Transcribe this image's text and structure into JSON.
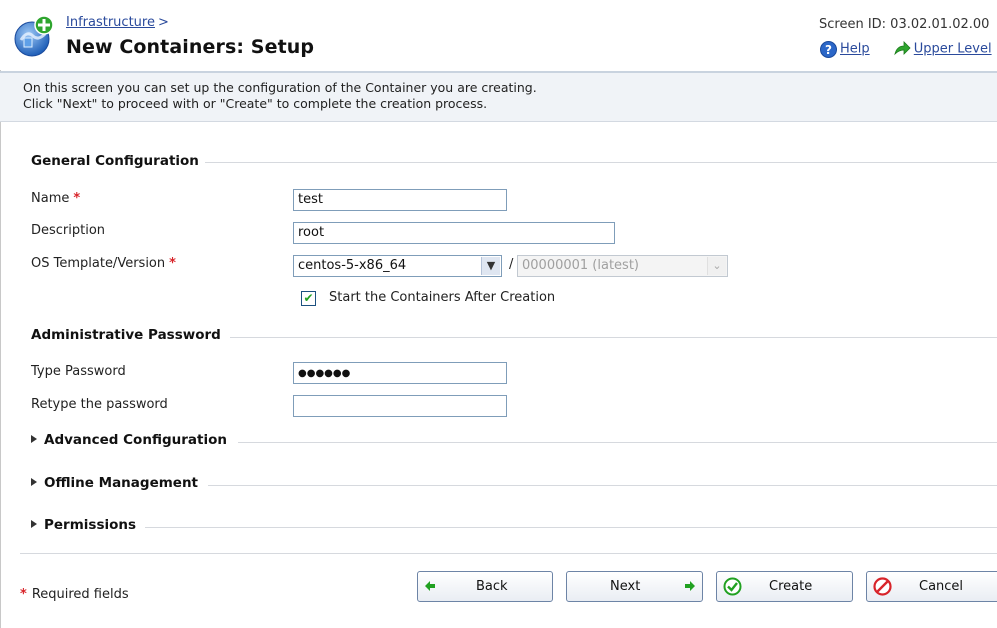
{
  "header": {
    "breadcrumb": "Infrastructure",
    "breadcrumb_sep": ">",
    "title": "New Containers: Setup",
    "screen_id": "Screen ID: 03.02.01.02.00",
    "help_label": "Help",
    "upper_level_label": "Upper Level"
  },
  "info": {
    "line1": "On this screen you can set up the configuration of the Container you are creating.",
    "line2": "Click \"Next\" to proceed with or \"Create\" to complete the creation process."
  },
  "general": {
    "title": "General Configuration",
    "name_label": "Name",
    "name_value": "test",
    "description_label": "Description",
    "description_value": "root",
    "os_label": "OS Template/Version",
    "os_template": "centos-5-x86_64",
    "os_version": "00000001 (latest)",
    "slash": "/",
    "start_after_label": "Start the Containers After Creation"
  },
  "password": {
    "title": "Administrative Password",
    "type_label": "Type Password",
    "type_value": "●●●●●●",
    "retype_label": "Retype the password",
    "retype_value": ""
  },
  "collapsed_sections": {
    "advanced": "Advanced Configuration",
    "offline": "Offline Management",
    "permissions": "Permissions"
  },
  "footer": {
    "required_star": "*",
    "required_note": "Required fields",
    "back": "Back",
    "next": "Next",
    "create": "Create",
    "cancel": "Cancel"
  },
  "icons": {
    "logo": "container-add-icon",
    "help": "help-icon",
    "upper_level": "up-arrow-icon",
    "back": "green-left-arrow-icon",
    "next": "green-right-arrow-icon",
    "create": "green-check-icon",
    "cancel": "red-no-icon"
  },
  "colors": {
    "link": "#2a4a9c",
    "required": "#d8242a",
    "info_bg": "#f0f3f7",
    "green": "#21a121",
    "red": "#d8242a"
  }
}
